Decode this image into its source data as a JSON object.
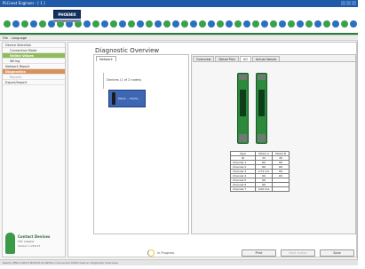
{
  "window": {
    "title": "PLCnext Engineer - [ 1 ]"
  },
  "banner": {
    "logo_text": "PHOENIX",
    "dot_colors": [
      "#3aa14a",
      "#2b6fc0",
      "#3aa14a",
      "#2b6fc0",
      "#3aa14a",
      "#2b6fc0",
      "#3aa14a",
      "#2b6fc0",
      "#3aa14a",
      "#2b6fc0",
      "#3aa14a",
      "#2b6fc0",
      "#3aa14a",
      "#2b6fc0",
      "#3aa14a",
      "#2b6fc0",
      "#3aa14a",
      "#2b6fc0",
      "#3aa14a",
      "#2b6fc0",
      "#3aa14a",
      "#2b6fc0",
      "#3aa14a",
      "#2b6fc0",
      "#3aa14a",
      "#2b6fc0",
      "#3aa14a",
      "#2b6fc0",
      "#3aa14a",
      "#2b6fc0",
      "#3aa14a",
      "#2b6fc0",
      "#3aa14a",
      "#2b6fc0",
      "#3aa14a",
      "#2b6fc0",
      "#3aa14a",
      "#2b6fc0",
      "#3aa14a",
      "#2b6fc0",
      "#3aa14a",
      "#2b6fc0",
      "#3aa14a"
    ]
  },
  "menu": {
    "file": "File",
    "language": "Language"
  },
  "sidebar": {
    "items": [
      {
        "label": "Device Selection",
        "style": "normal"
      },
      {
        "label": "Connection Mode",
        "style": "sub"
      },
      {
        "label": "Online Values",
        "style": "active-green"
      },
      {
        "label": "Wiring",
        "style": "sub"
      },
      {
        "label": "Network Report",
        "style": "normal"
      },
      {
        "label": "Diagnostics",
        "style": "active-orange"
      },
      {
        "label": "Reports",
        "style": "light"
      },
      {
        "label": "Export/Import",
        "style": "normal"
      }
    ],
    "brand_title": "Contact Devices",
    "brand_line2": "FDT Adapter",
    "brand_line3": "Version 1.220.47"
  },
  "main": {
    "title": "Diagnostic Overview",
    "left_tab": "Network",
    "tree_root": "Devices (1 of 2 nodes)",
    "tree_device": "MACX ... Ex/IS/...",
    "right_tabs": [
      "Overview",
      "Detail Port",
      "I/O",
      "Actual Values"
    ],
    "active_tab_index": 2
  },
  "table": {
    "headers": [
      "Type",
      "MACX A",
      "MACX B"
    ],
    "subheaders": [
      "ID",
      "33",
      "35"
    ],
    "rows": [
      {
        "label": "Channel 1",
        "a": "OK",
        "b": "OK"
      },
      {
        "label": "Channel 2",
        "a": "OK",
        "b": "OK"
      },
      {
        "label": "Channel 3",
        "a": "2.72 mA",
        "b": "OK"
      },
      {
        "label": "Channel 4",
        "a": "OK",
        "b": "OK"
      },
      {
        "label": "Channel 5",
        "a": "OK",
        "b": ""
      },
      {
        "label": "Channel 6",
        "a": "OK",
        "b": ""
      },
      {
        "label": "Channel 7",
        "a": "4.00 mA",
        "b": ""
      }
    ]
  },
  "footer": {
    "spinner_label": "In Progress",
    "btn_print": "Print",
    "btn_next": "Next Action",
    "btn_save": "Save"
  },
  "status": {
    "text": "Ready    Offline    MACX MCR-EX-SL-RPSSI-I    Connected    COM1    Device: Diagnostic Overview"
  }
}
